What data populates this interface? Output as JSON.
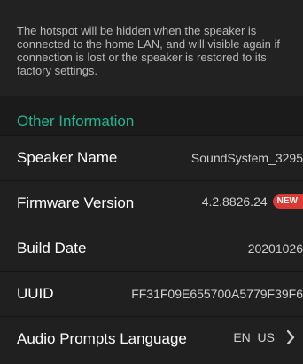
{
  "notice": {
    "text": "The hotspot will be hidden when the speaker is connected to the home LAN, and will visible again if connection is lost or the speaker is restored to its factory settings."
  },
  "section": {
    "title": "Other Information"
  },
  "rows": [
    {
      "label": "Speaker Name",
      "value": "SoundSystem_3295"
    },
    {
      "label": "Firmware Version",
      "value": "4.2.8826.24",
      "badge": "NEW"
    },
    {
      "label": "Build Date",
      "value": "20201026"
    },
    {
      "label": "UUID",
      "value": "FF31F09E655700A5779F39F6"
    },
    {
      "label": "Audio Prompts Language",
      "value": "EN_US"
    }
  ],
  "colors": {
    "accent": "#23b58f",
    "badge": "#d93a34",
    "background": "#1f1f1f"
  },
  "icons": {
    "language_row": "chevron-right-icon"
  }
}
